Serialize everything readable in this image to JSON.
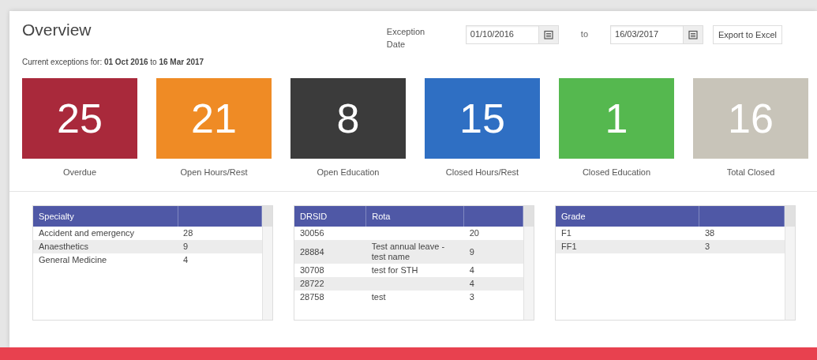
{
  "title": "Overview",
  "filter": {
    "label": "Exception Date",
    "from": "01/10/2016",
    "separator": "to",
    "to": "16/03/2017",
    "export_button": "Export to Excel"
  },
  "summary": {
    "prefix": "Current exceptions for: ",
    "from": "01 Oct 2016",
    "middle": " to ",
    "to": "16 Mar 2017"
  },
  "tiles": [
    {
      "count": "25",
      "label": "Overdue",
      "color": "#a9293b"
    },
    {
      "count": "21",
      "label": "Open Hours/Rest",
      "color": "#ef8b25"
    },
    {
      "count": "8",
      "label": "Open Education",
      "color": "#3b3b3b"
    },
    {
      "count": "15",
      "label": "Closed Hours/Rest",
      "color": "#2f6fc3"
    },
    {
      "count": "1",
      "label": "Closed Education",
      "color": "#55b84f"
    },
    {
      "count": "16",
      "label": "Total Closed",
      "color": "#c8c4b9"
    }
  ],
  "tables": [
    {
      "columns": [
        "Specialty",
        ""
      ],
      "rows": [
        [
          "Accident and emergency",
          "28"
        ],
        [
          "Anaesthetics",
          "9"
        ],
        [
          "General Medicine",
          "4"
        ]
      ]
    },
    {
      "columns": [
        "DRSID",
        "Rota",
        ""
      ],
      "rows": [
        [
          "30056",
          "",
          "20"
        ],
        [
          "28884",
          "Test annual leave - test name",
          "9"
        ],
        [
          "30708",
          "test for STH",
          "4"
        ],
        [
          "28722",
          "",
          "4"
        ],
        [
          "28758",
          "test",
          "3"
        ]
      ]
    },
    {
      "columns": [
        "Grade",
        ""
      ],
      "rows": [
        [
          "F1",
          "38"
        ],
        [
          "FF1",
          "3"
        ]
      ]
    }
  ]
}
